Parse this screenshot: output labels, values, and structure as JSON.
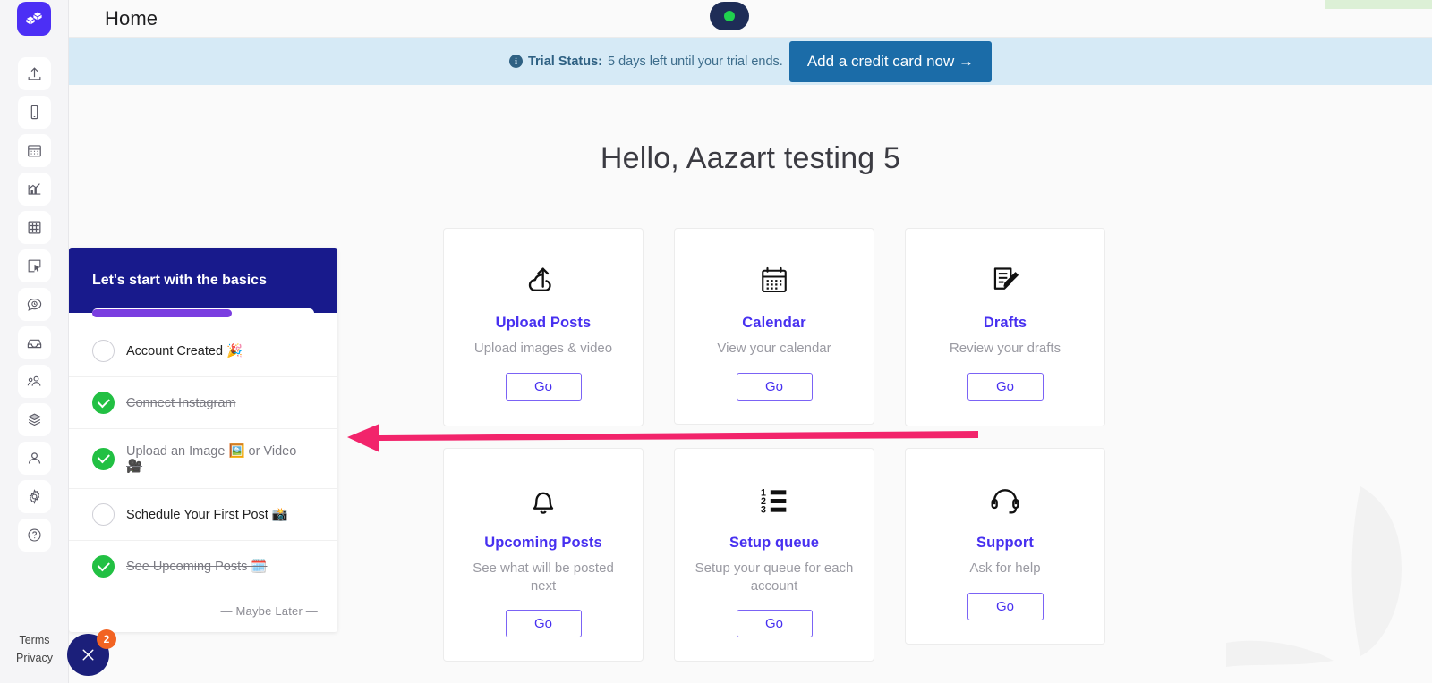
{
  "app": {
    "logo_icon": "cubes-logo-icon",
    "title": "Home"
  },
  "header": {
    "avatar_icon": "avatar-pill",
    "status_dot_color": "#20d14e",
    "avatar_bg": "#1e2d57"
  },
  "banner": {
    "info_icon": "info-icon",
    "info_glyph": "i",
    "label_bold": "Trial Status:",
    "label_rest": "5 days left until your trial ends.",
    "cta_label": "Add a credit card now →",
    "bg_color": "#d6eaf6",
    "cta_color": "#1b6ca8"
  },
  "main": {
    "greeting": "Hello, Aazart testing 5"
  },
  "rail": {
    "items": [
      {
        "icon": "upload-icon"
      },
      {
        "icon": "mobile-device-icon"
      },
      {
        "icon": "calendar-icon"
      },
      {
        "icon": "analytics-bar-chart-icon"
      },
      {
        "icon": "grid-hash-icon"
      },
      {
        "icon": "cursor-select-icon"
      },
      {
        "icon": "clock-chat-icon"
      },
      {
        "icon": "inbox-tray-icon"
      },
      {
        "icon": "users-group-icon"
      },
      {
        "icon": "layers-stack-icon"
      },
      {
        "icon": "user-profile-icon"
      },
      {
        "icon": "gear-settings-icon"
      },
      {
        "icon": "help-question-icon"
      }
    ],
    "legal": {
      "terms": "Terms",
      "privacy": "Privacy"
    }
  },
  "cards": [
    {
      "icon": "cloud-upload-icon",
      "title": "Upload Posts",
      "desc": "Upload images & video",
      "go_label": "Go"
    },
    {
      "icon": "calendar-icon",
      "title": "Calendar",
      "desc": "View your calendar",
      "go_label": "Go"
    },
    {
      "icon": "draft-edit-icon",
      "title": "Drafts",
      "desc": "Review your drafts",
      "go_label": "Go"
    },
    {
      "icon": "bell-icon",
      "title": "Upcoming Posts",
      "desc": "See what will be posted next",
      "go_label": "Go"
    },
    {
      "icon": "numbered-list-icon",
      "title": "Setup queue",
      "desc": "Setup your queue for each account",
      "go_label": "Go"
    },
    {
      "icon": "headset-support-icon",
      "title": "Support",
      "desc": "Ask for help",
      "go_label": "Go"
    }
  ],
  "checklist": {
    "title": "Let's start with the basics",
    "progress_percent": 63,
    "progress_color": "#7a3ee0",
    "header_color": "#181a8c",
    "items": [
      {
        "label": "Account Created 🎉",
        "done": false
      },
      {
        "label": "Connect Instagram",
        "done": true
      },
      {
        "label": "Upload an Image 🖼️ or Video 🎥",
        "done": true
      },
      {
        "label": "Schedule Your First Post 📸",
        "done": false
      },
      {
        "label": "See Upcoming Posts 🗓️",
        "done": true
      }
    ],
    "maybe_later": "—  Maybe Later  —"
  },
  "chat": {
    "icon": "close-x-icon",
    "badge_count": "2",
    "bubble_color": "#1b1f7a",
    "badge_color": "#f26322"
  },
  "annotation": {
    "arrow_icon": "left-pointing-arrow",
    "color": "#f2246b"
  }
}
